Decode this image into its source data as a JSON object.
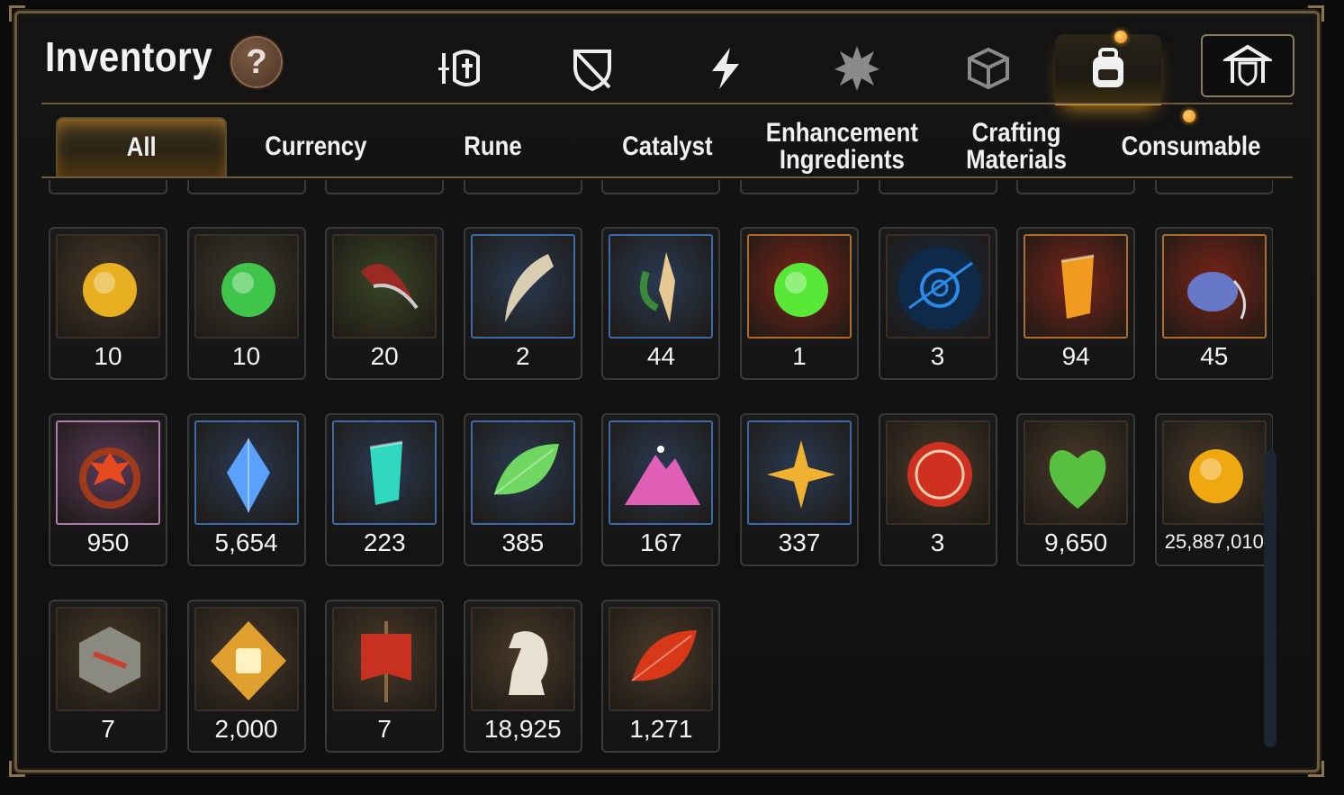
{
  "window": {
    "title": "Inventory",
    "help_symbol": "?"
  },
  "top_tabs": [
    {
      "icon": "knight-helmet-icon"
    },
    {
      "icon": "broken-shield-icon"
    },
    {
      "icon": "lightning-icon"
    },
    {
      "icon": "splash-emblem-icon"
    },
    {
      "icon": "cube-icon"
    },
    {
      "icon": "backpack-icon",
      "active": true
    },
    {
      "icon": "guild-hall-icon"
    }
  ],
  "sub_tabs": [
    {
      "label": "All",
      "active": true
    },
    {
      "label": "Currency"
    },
    {
      "label": "Rune"
    },
    {
      "label": "Catalyst"
    },
    {
      "label": "Enhancement\nIngredients"
    },
    {
      "label": "Crafting\nMaterials"
    },
    {
      "label": "Consumable"
    }
  ],
  "items_row1": [
    {
      "icon": "yellow-gem-icon",
      "qty": "10",
      "color": "#e8b020"
    },
    {
      "icon": "green-gem-icon",
      "qty": "10",
      "color": "#3fc64a"
    },
    {
      "icon": "claw-icon",
      "qty": "20",
      "color": "#9b2a24"
    },
    {
      "icon": "fang-icon",
      "qty": "2",
      "color": "#d8cdb0"
    },
    {
      "icon": "root-herb-icon",
      "qty": "44",
      "color": "#e6c890"
    },
    {
      "icon": "green-orb-icon",
      "qty": "1",
      "color": "#58e838"
    },
    {
      "icon": "blue-rune-orb-icon",
      "qty": "3",
      "color": "#2a8ae8"
    },
    {
      "icon": "fire-crystal-icon",
      "qty": "94",
      "color": "#f09a20"
    },
    {
      "icon": "stone-pendant-icon",
      "qty": "45",
      "color": "#6878c8"
    }
  ],
  "items_row2": [
    {
      "icon": "flower-ring-icon",
      "qty": "950",
      "color": "#e84a20"
    },
    {
      "icon": "blue-diamond-icon",
      "qty": "5,654",
      "color": "#5aa0ff"
    },
    {
      "icon": "teal-crystal-icon",
      "qty": "223",
      "color": "#30d8c0"
    },
    {
      "icon": "leaf-icon",
      "qty": "385",
      "color": "#70d860"
    },
    {
      "icon": "pink-ore-icon",
      "qty": "167",
      "color": "#e060b8"
    },
    {
      "icon": "star-amulet-icon",
      "qty": "337",
      "color": "#f0b030"
    },
    {
      "icon": "red-seal-icon",
      "qty": "3",
      "color": "#d03020"
    },
    {
      "icon": "green-heart-icon",
      "qty": "9,650",
      "color": "#58c040"
    },
    {
      "icon": "gold-coin-icon",
      "qty": "25,887,010",
      "color": "#f0a810"
    }
  ],
  "items_row3": [
    {
      "icon": "compass-stone-icon",
      "qty": "7",
      "color": "#c84030"
    },
    {
      "icon": "fist-emblem-icon",
      "qty": "2,000",
      "color": "#e0a030"
    },
    {
      "icon": "war-banner-icon",
      "qty": "7",
      "color": "#c83020"
    },
    {
      "icon": "chess-knight-icon",
      "qty": "18,925",
      "color": "#e8e0d0"
    },
    {
      "icon": "red-leaf-icon",
      "qty": "1,271",
      "color": "#d83818"
    }
  ]
}
